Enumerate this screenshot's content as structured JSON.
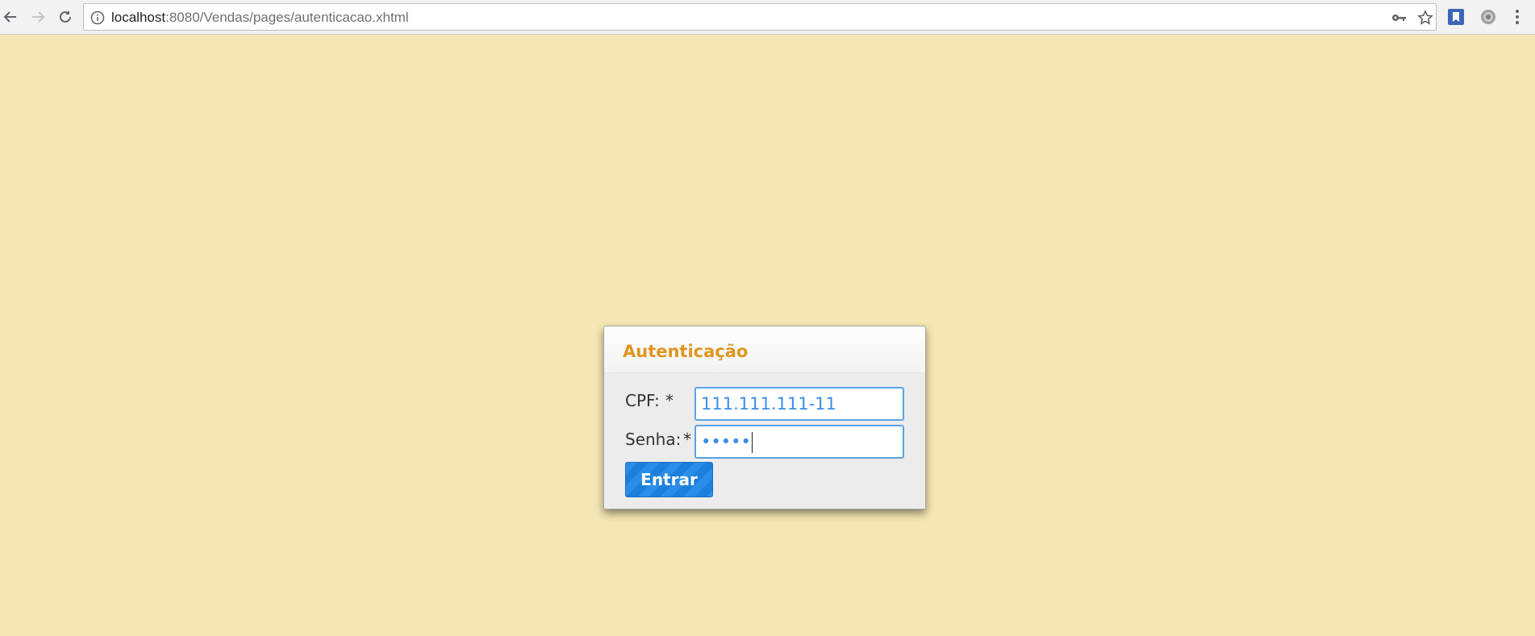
{
  "browser": {
    "url_host": "localhost",
    "url_path": ":8080/Vendas/pages/autenticacao.xhtml"
  },
  "dialog": {
    "title": "Autenticação",
    "cpf_label": "CPF:",
    "cpf_required": "*",
    "cpf_value": "111.111.111-11",
    "senha_label": "Senha:",
    "senha_required": "*",
    "senha_masked": "•••••",
    "submit_label": "Entrar"
  },
  "colors": {
    "page_background": "#f5e7b3",
    "title_accent": "#e0951f",
    "button_blue": "#2a8ee8",
    "input_focus": "#5aa2e6"
  },
  "icons": [
    "back-arrow-icon",
    "forward-arrow-icon",
    "reload-icon",
    "info-icon",
    "key-icon",
    "star-icon",
    "bookmark-extension-icon",
    "settings-extension-icon",
    "menu-dots-icon"
  ]
}
